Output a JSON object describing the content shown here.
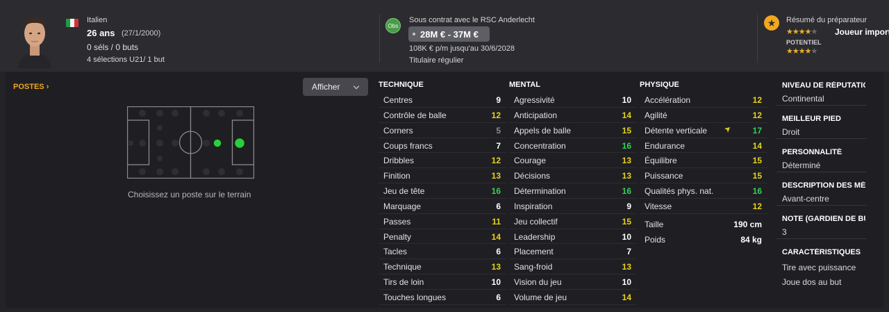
{
  "player": {
    "nationality": "Italien",
    "age_bold": "26 ans",
    "birth_date": "(27/1/2000)",
    "club_stats": "0 séls / 0 buts",
    "intl_stats": "4 sélections U21/ 1 but"
  },
  "contract": {
    "badge": "Obs",
    "status": "Sous contrat avec le RSC Anderlecht",
    "value_range": "28M € - 37M €",
    "wage": "108K € p/m jusqu'au 30/6/2028",
    "role": "Titulaire régulier"
  },
  "coach": {
    "title": "Résumé du préparateur",
    "ability_stars": 3.5,
    "summary": "Joueur important",
    "potential_label": "POTENTIEL",
    "potential_stars": 3.5
  },
  "positions": {
    "title": "POSTES",
    "hint": "Choisissez un poste sur le terrain"
  },
  "controls": {
    "show_label": "Afficher"
  },
  "technique": {
    "title": "TECHNIQUE",
    "attrs": [
      {
        "name": "Centres",
        "value": "9"
      },
      {
        "name": "Contrôle de balle",
        "value": "12"
      },
      {
        "name": "Corners",
        "value": "5"
      },
      {
        "name": "Coups francs",
        "value": "7"
      },
      {
        "name": "Dribbles",
        "value": "12"
      },
      {
        "name": "Finition",
        "value": "13"
      },
      {
        "name": "Jeu de tête",
        "value": "16"
      },
      {
        "name": "Marquage",
        "value": "6"
      },
      {
        "name": "Passes",
        "value": "11"
      },
      {
        "name": "Penalty",
        "value": "14"
      },
      {
        "name": "Tacles",
        "value": "6"
      },
      {
        "name": "Technique",
        "value": "13"
      },
      {
        "name": "Tirs de loin",
        "value": "10"
      },
      {
        "name": "Touches longues",
        "value": "6"
      }
    ]
  },
  "mental": {
    "title": "MENTAL",
    "attrs": [
      {
        "name": "Agressivité",
        "value": "10"
      },
      {
        "name": "Anticipation",
        "value": "14"
      },
      {
        "name": "Appels de balle",
        "value": "15"
      },
      {
        "name": "Concentration",
        "value": "16"
      },
      {
        "name": "Courage",
        "value": "13"
      },
      {
        "name": "Décisions",
        "value": "13"
      },
      {
        "name": "Détermination",
        "value": "16"
      },
      {
        "name": "Inspiration",
        "value": "9"
      },
      {
        "name": "Jeu collectif",
        "value": "15"
      },
      {
        "name": "Leadership",
        "value": "10"
      },
      {
        "name": "Placement",
        "value": "7"
      },
      {
        "name": "Sang-froid",
        "value": "13"
      },
      {
        "name": "Vision du jeu",
        "value": "10"
      },
      {
        "name": "Volume de jeu",
        "value": "14"
      }
    ]
  },
  "physique": {
    "title": "PHYSIQUE",
    "attrs": [
      {
        "name": "Accélération",
        "value": "12"
      },
      {
        "name": "Agilité",
        "value": "12"
      },
      {
        "name": "Détente verticale",
        "value": "17"
      },
      {
        "name": "Endurance",
        "value": "14"
      },
      {
        "name": "Équilibre",
        "value": "15"
      },
      {
        "name": "Puissance",
        "value": "15"
      },
      {
        "name": "Qualités phys. nat.",
        "value": "16"
      },
      {
        "name": "Vitesse",
        "value": "12"
      }
    ],
    "height_label": "Taille",
    "height_value": "190 cm",
    "weight_label": "Poids",
    "weight_value": "84 kg"
  },
  "sidebar": {
    "items": [
      {
        "title": "NIVEAU DE RÉPUTATION",
        "value": "Continental"
      },
      {
        "title": "MEILLEUR PIED",
        "value": "Droit"
      },
      {
        "title": "PERSONNALITÉ",
        "value": "Déterminé"
      },
      {
        "title": "DESCRIPTION DES MÉDIAS",
        "value": "Avant-centre"
      },
      {
        "title": "NOTE (GARDIEN DE BUT)",
        "value": "3"
      }
    ],
    "traits_title": "CARACTÉRISTIQUES",
    "traits": [
      "Tire avec puissance",
      "Joue dos au but"
    ]
  },
  "colors": {
    "background": "#242428",
    "accent_orange": "#f2a81d",
    "value_high_green": "#34d15a",
    "value_mid_yellow": "#e6d21e"
  }
}
